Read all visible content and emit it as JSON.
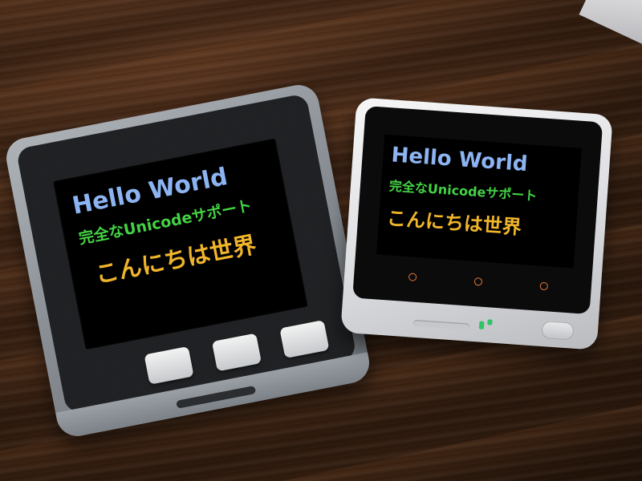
{
  "scene": {
    "description_tag": "two-m5stack-devices-on-wooden-table"
  },
  "left_device": {
    "screen": {
      "line1": "Hello World",
      "line2": "完全なUnicodeサポート",
      "line3": "こんにちは世界"
    },
    "buttons": [
      "",
      "",
      ""
    ]
  },
  "right_device": {
    "screen": {
      "line1": "Hello World",
      "line2": "完全なUnicodeサポート",
      "line3": "こんにちは世界"
    }
  },
  "colors": {
    "hello": "#8db4f2",
    "unicode": "#44d244",
    "konnichiwa": "#f0b52b",
    "touch_marker": "#e0763a",
    "led": "#2fc36a"
  }
}
